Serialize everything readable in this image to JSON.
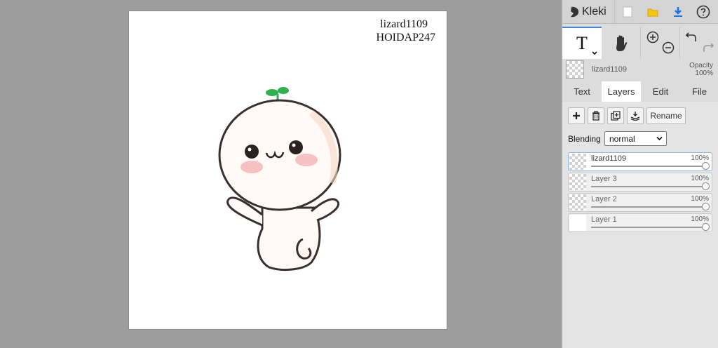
{
  "canvas": {
    "text_line_1": "lizard1109",
    "text_line_2": "HOIDAP247"
  },
  "app": {
    "name": "Kleki"
  },
  "toolbar": {
    "icons": [
      "new-file-icon",
      "open-folder-icon",
      "download-icon",
      "help-icon"
    ],
    "active_tool_glyph": "T"
  },
  "current_layer": {
    "name": "lizard1109",
    "opacity_label": "Opacity",
    "opacity_value": "100%"
  },
  "tabs": [
    {
      "label": "Text"
    },
    {
      "label": "Layers",
      "active": true
    },
    {
      "label": "Edit"
    },
    {
      "label": "File"
    }
  ],
  "layer_actions": {
    "rename_label": "Rename"
  },
  "blending": {
    "label": "Blending",
    "value": "normal"
  },
  "layers": [
    {
      "name": "lizard1109",
      "opacity": "100%",
      "selected": true
    },
    {
      "name": "Layer 3",
      "opacity": "100%"
    },
    {
      "name": "Layer 2",
      "opacity": "100%"
    },
    {
      "name": "Layer 1",
      "opacity": "100%"
    }
  ],
  "colors": {
    "accent": "#3f88d6",
    "download": "#1a73e8",
    "folder": "#f5c518",
    "sprout": "#2fb24c",
    "blush": "#f4a6ae"
  }
}
